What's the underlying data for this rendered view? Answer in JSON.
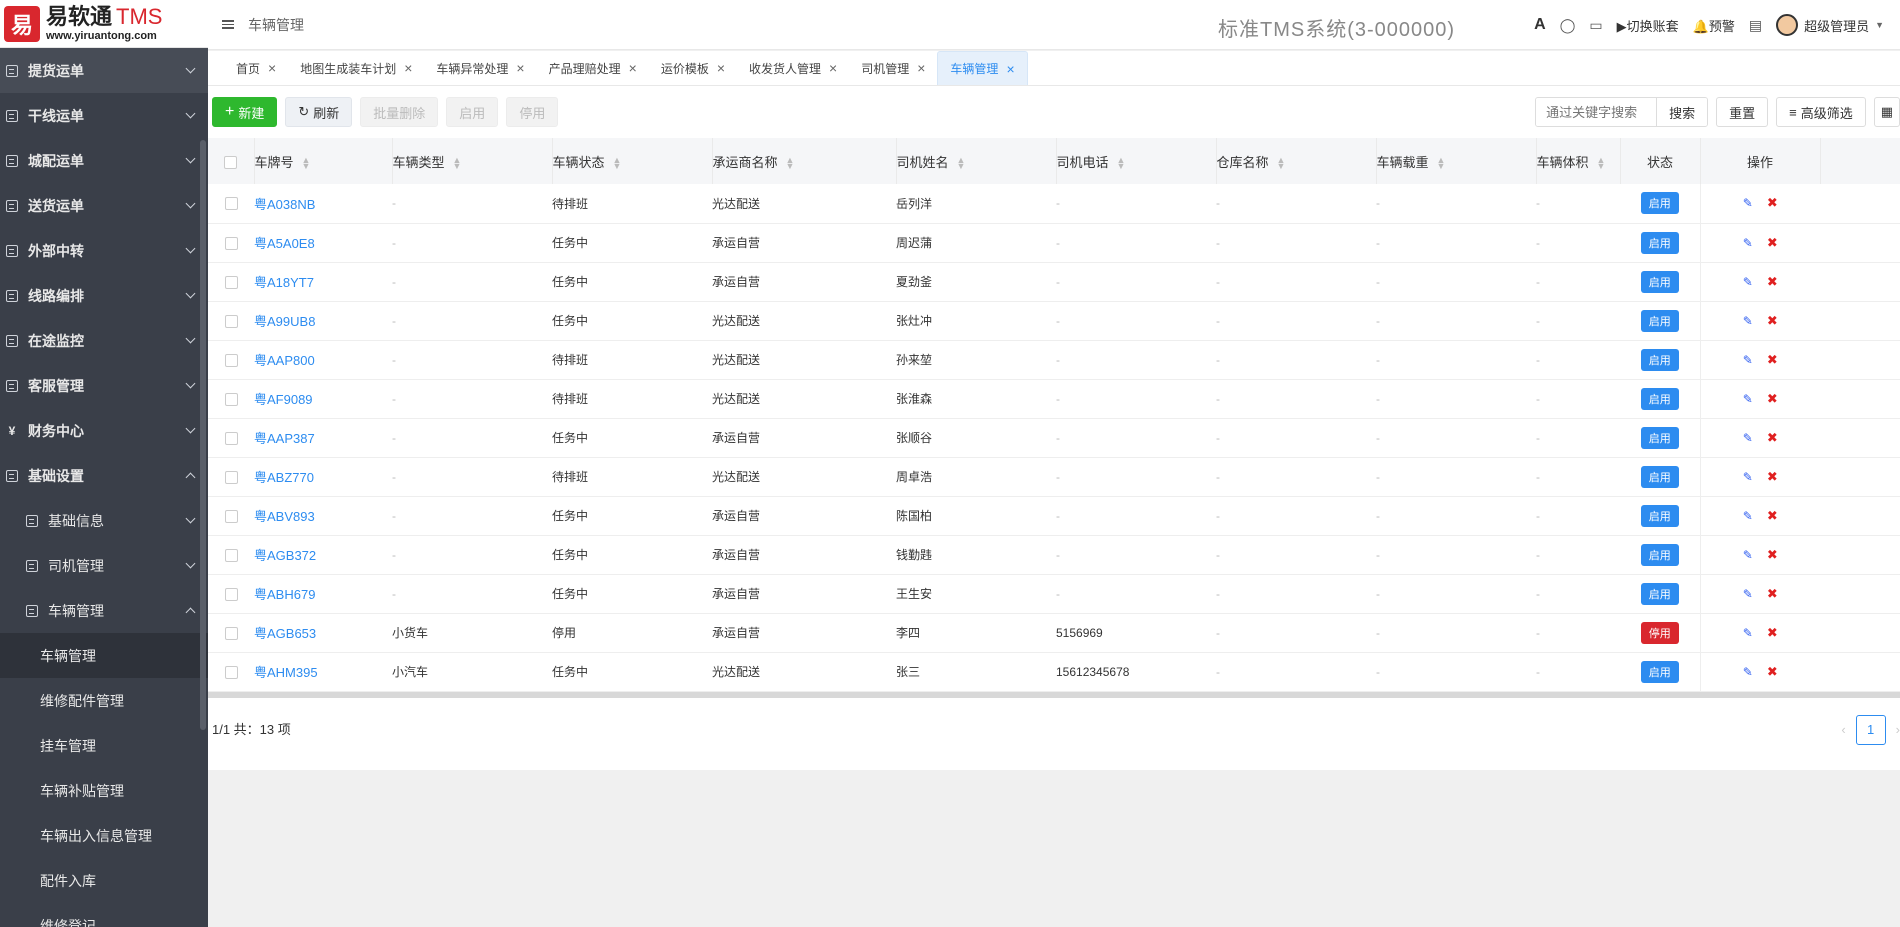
{
  "logo": {
    "mark": "易",
    "title": "易软通",
    "tms": "TMS",
    "url": "www.yiruantong.com"
  },
  "sidebar": {
    "items": [
      {
        "label": "提货运单",
        "level": 1,
        "expanded": false
      },
      {
        "label": "干线运单",
        "level": 1,
        "expanded": false
      },
      {
        "label": "城配运单",
        "level": 1,
        "expanded": false
      },
      {
        "label": "送货运单",
        "level": 1,
        "expanded": false
      },
      {
        "label": "外部中转",
        "level": 1,
        "expanded": false
      },
      {
        "label": "线路编排",
        "level": 1,
        "expanded": false
      },
      {
        "label": "在途监控",
        "level": 1,
        "expanded": false
      },
      {
        "label": "客服管理",
        "level": 1,
        "expanded": false
      },
      {
        "label": "财务中心",
        "level": 1,
        "expanded": false,
        "icon": "yen-icon"
      },
      {
        "label": "基础设置",
        "level": 1,
        "expanded": true
      },
      {
        "label": "基础信息",
        "level": 2,
        "expanded": false
      },
      {
        "label": "司机管理",
        "level": 2,
        "expanded": false
      },
      {
        "label": "车辆管理",
        "level": 2,
        "expanded": true
      },
      {
        "label": "车辆管理",
        "level": 3,
        "active": true
      },
      {
        "label": "维修配件管理",
        "level": 3
      },
      {
        "label": "挂车管理",
        "level": 3
      },
      {
        "label": "车辆补贴管理",
        "level": 3
      },
      {
        "label": "车辆出入信息管理",
        "level": 3
      },
      {
        "label": "配件入库",
        "level": 3
      },
      {
        "label": "维修登记",
        "level": 3
      }
    ]
  },
  "header": {
    "breadcrumb": "车辆管理",
    "system_title": "标准TMS系统(3-000000)",
    "font_icon": "A",
    "switch_account": "切换账套",
    "alert": "预警",
    "user": "超级管理员"
  },
  "tabs": [
    {
      "label": "首页"
    },
    {
      "label": "地图生成装车计划"
    },
    {
      "label": "车辆异常处理"
    },
    {
      "label": "产品理赔处理"
    },
    {
      "label": "运价模板"
    },
    {
      "label": "收发货人管理"
    },
    {
      "label": "司机管理"
    },
    {
      "label": "车辆管理",
      "active": true
    }
  ],
  "toolbar": {
    "new": "新建",
    "refresh": "刷新",
    "batch_delete": "批量删除",
    "enable": "启用",
    "disable": "停用",
    "search_placeholder": "通过关键字搜索",
    "search": "搜索",
    "reset": "重置",
    "advanced_filter": "高级筛选"
  },
  "table": {
    "columns": [
      "车牌号",
      "车辆类型",
      "车辆状态",
      "承运商名称",
      "司机姓名",
      "司机电话",
      "仓库名称",
      "车辆载重",
      "车辆体积",
      "状态",
      "操作"
    ],
    "rows": [
      {
        "plate": "粤A038NB",
        "type": "-",
        "vstatus": "待排班",
        "carrier": "光达配送",
        "driver": "岳列洋",
        "phone": "-",
        "warehouse": "-",
        "load": "-",
        "volume": "-",
        "status": "启用"
      },
      {
        "plate": "粤A5A0E8",
        "type": "-",
        "vstatus": "任务中",
        "carrier": "承运自营",
        "driver": "周迟蒲",
        "phone": "-",
        "warehouse": "-",
        "load": "-",
        "volume": "-",
        "status": "启用"
      },
      {
        "plate": "粤A18YT7",
        "type": "-",
        "vstatus": "任务中",
        "carrier": "承运自营",
        "driver": "夏劲釜",
        "phone": "-",
        "warehouse": "-",
        "load": "-",
        "volume": "-",
        "status": "启用"
      },
      {
        "plate": "粤A99UB8",
        "type": "-",
        "vstatus": "任务中",
        "carrier": "光达配送",
        "driver": "张灶冲",
        "phone": "-",
        "warehouse": "-",
        "load": "-",
        "volume": "-",
        "status": "启用"
      },
      {
        "plate": "粤AAP800",
        "type": "-",
        "vstatus": "待排班",
        "carrier": "光达配送",
        "driver": "孙来堃",
        "phone": "-",
        "warehouse": "-",
        "load": "-",
        "volume": "-",
        "status": "启用"
      },
      {
        "plate": "粤AF9089",
        "type": "-",
        "vstatus": "待排班",
        "carrier": "光达配送",
        "driver": "张淮森",
        "phone": "-",
        "warehouse": "-",
        "load": "-",
        "volume": "-",
        "status": "启用"
      },
      {
        "plate": "粤AAP387",
        "type": "-",
        "vstatus": "任务中",
        "carrier": "承运自营",
        "driver": "张顺谷",
        "phone": "-",
        "warehouse": "-",
        "load": "-",
        "volume": "-",
        "status": "启用"
      },
      {
        "plate": "粤ABZ770",
        "type": "-",
        "vstatus": "待排班",
        "carrier": "光达配送",
        "driver": "周卓浩",
        "phone": "-",
        "warehouse": "-",
        "load": "-",
        "volume": "-",
        "status": "启用"
      },
      {
        "plate": "粤ABV893",
        "type": "-",
        "vstatus": "任务中",
        "carrier": "承运自营",
        "driver": "陈国柏",
        "phone": "-",
        "warehouse": "-",
        "load": "-",
        "volume": "-",
        "status": "启用"
      },
      {
        "plate": "粤AGB372",
        "type": "-",
        "vstatus": "任务中",
        "carrier": "承运自营",
        "driver": "钱勤韪",
        "phone": "-",
        "warehouse": "-",
        "load": "-",
        "volume": "-",
        "status": "启用"
      },
      {
        "plate": "粤ABH679",
        "type": "-",
        "vstatus": "任务中",
        "carrier": "承运自营",
        "driver": "王生安",
        "phone": "-",
        "warehouse": "-",
        "load": "-",
        "volume": "-",
        "status": "启用"
      },
      {
        "plate": "粤AGB653",
        "type": "小货车",
        "vstatus": "停用",
        "carrier": "承运自营",
        "driver": "李四",
        "phone": "5156969",
        "warehouse": "-",
        "load": "-",
        "volume": "-",
        "status": "停用"
      },
      {
        "plate": "粤AHM395",
        "type": "小汽车",
        "vstatus": "任务中",
        "carrier": "光达配送",
        "driver": "张三",
        "phone": "15612345678",
        "warehouse": "-",
        "load": "-",
        "volume": "-",
        "status": "启用"
      }
    ]
  },
  "footer": {
    "summary": "1/1 共：13 项",
    "page": "1"
  },
  "colors": {
    "accent": "#2d8cf0",
    "new_button": "#2eb82e",
    "stop_badge": "#d9272e",
    "sidebar": "#3a3f49"
  }
}
